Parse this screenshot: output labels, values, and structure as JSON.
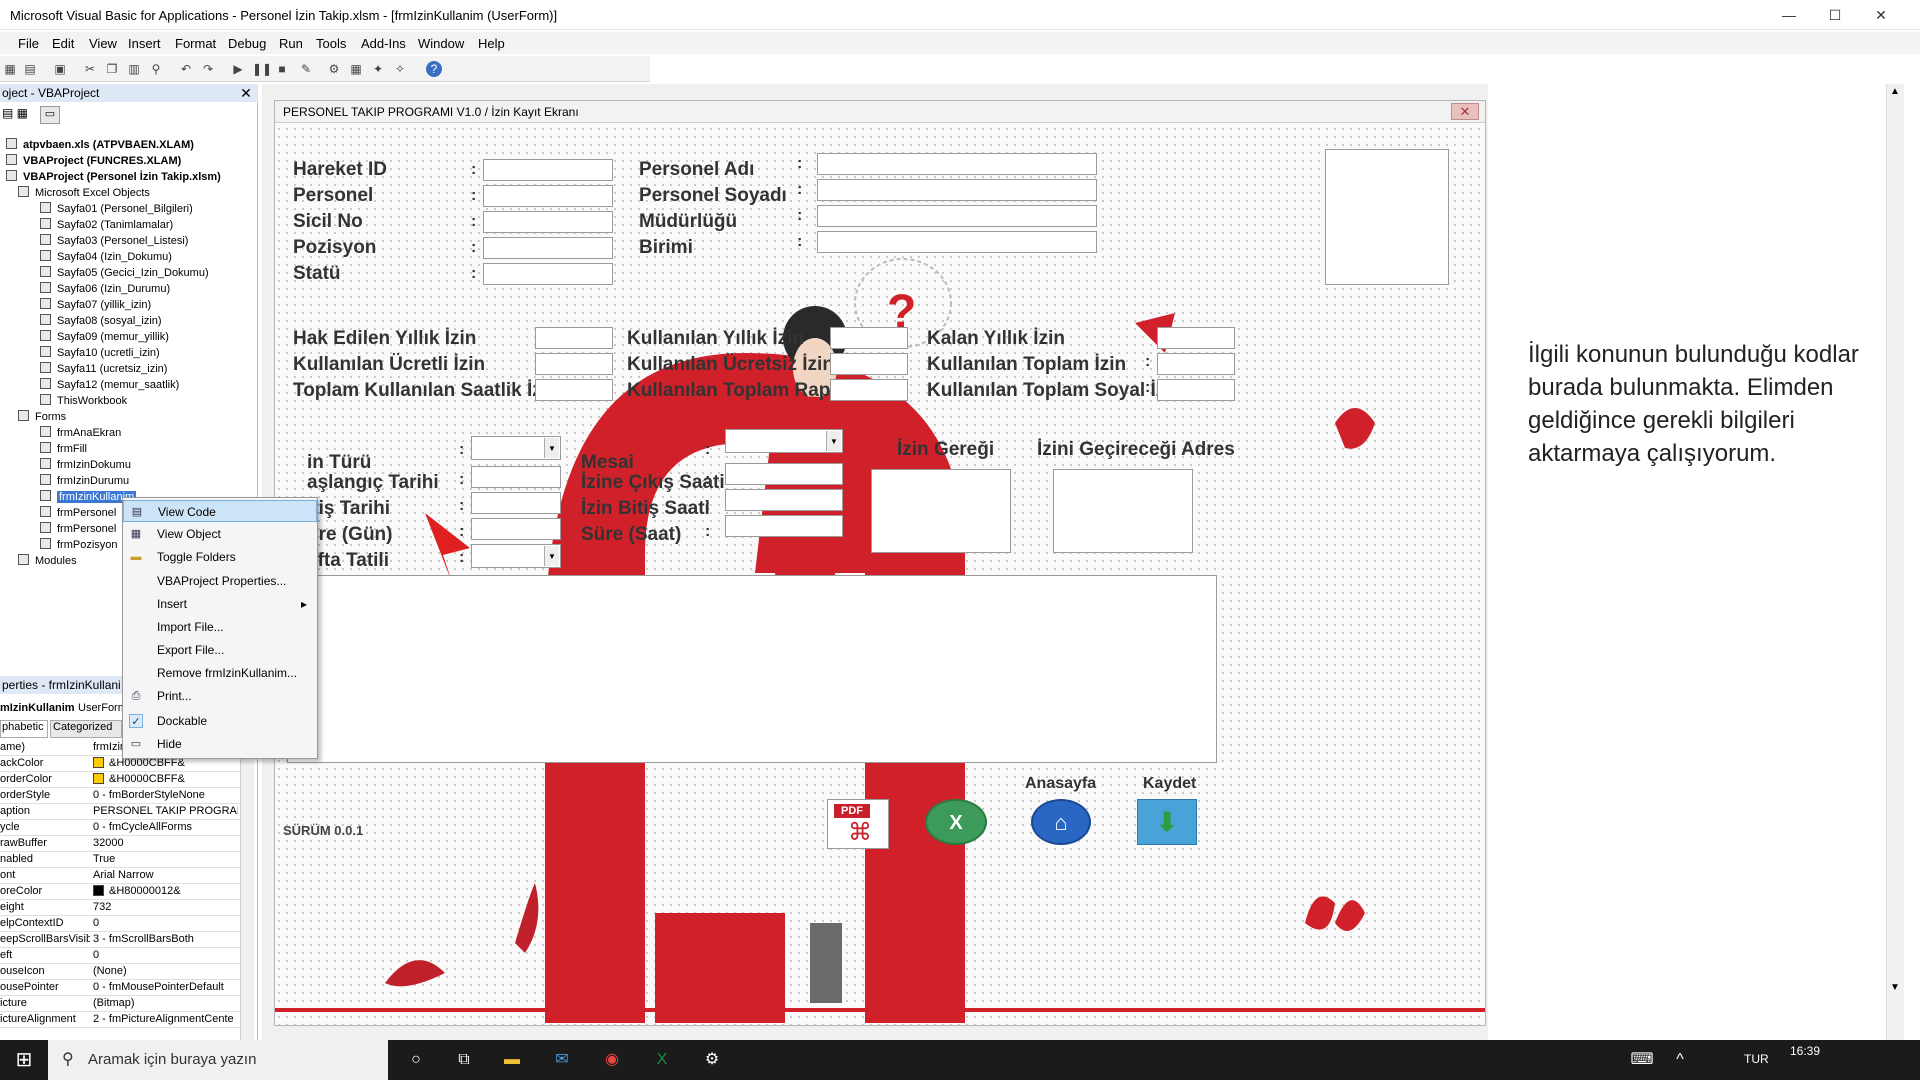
{
  "window": {
    "title": "Microsoft Visual Basic for Applications - Personel İzin Takip.xlsm - [frmIzinKullanim (UserForm)]"
  },
  "menu": [
    "File",
    "Edit",
    "View",
    "Insert",
    "Format",
    "Debug",
    "Run",
    "Tools",
    "Add-Ins",
    "Window",
    "Help"
  ],
  "project_explorer": {
    "title": "oject - VBAProject",
    "items": [
      {
        "label": "atpvbaen.xls (ATPVBAEN.XLAM)",
        "bold": true
      },
      {
        "label": "VBAProject (FUNCRES.XLAM)",
        "bold": true
      },
      {
        "label": "VBAProject (Personel İzin Takip.xlsm)",
        "bold": true
      },
      {
        "label": "Microsoft Excel Objects"
      },
      {
        "label": "Sayfa01 (Personel_Bilgileri)"
      },
      {
        "label": "Sayfa02 (Tanimlamalar)"
      },
      {
        "label": "Sayfa03 (Personel_Listesi)"
      },
      {
        "label": "Sayfa04 (Izin_Dokumu)"
      },
      {
        "label": "Sayfa05 (Gecici_Izin_Dokumu)"
      },
      {
        "label": "Sayfa06 (Izin_Durumu)"
      },
      {
        "label": "Sayfa07 (yillik_izin)"
      },
      {
        "label": "Sayfa08 (sosyal_izin)"
      },
      {
        "label": "Sayfa09 (memur_yillik)"
      },
      {
        "label": "Sayfa10 (ucretli_izin)"
      },
      {
        "label": "Sayfa11 (ucretsiz_izin)"
      },
      {
        "label": "Sayfa12 (memur_saatlik)"
      },
      {
        "label": "ThisWorkbook"
      },
      {
        "label": "Forms"
      },
      {
        "label": "frmAnaEkran"
      },
      {
        "label": "frmFill"
      },
      {
        "label": "frmIzinDokumu"
      },
      {
        "label": "frmIzinDurumu"
      },
      {
        "label": "frmIzinKullanim"
      },
      {
        "label": "frmPersonel"
      },
      {
        "label": "frmPersonel"
      },
      {
        "label": "frmPozisyon"
      },
      {
        "label": "Modules"
      }
    ]
  },
  "context_menu": {
    "items": [
      "View Code",
      "View Object",
      "Toggle Folders",
      "VBAProject Properties...",
      "Insert",
      "Import File...",
      "Export File...",
      "Remove frmIzinKullanim...",
      "Print...",
      "Dockable",
      "Hide"
    ]
  },
  "properties": {
    "title": "perties - frmIzinKullani",
    "object": "mIzinKullanim",
    "object_type": "UserForm",
    "tabs": [
      "phabetic",
      "Categorized"
    ],
    "rows": [
      {
        "k": "ame)",
        "v": "frmIzinKullanim"
      },
      {
        "k": "ackColor",
        "v": "&H0000CBFF&",
        "swatch": "#ffcb00"
      },
      {
        "k": "orderColor",
        "v": "&H0000CBFF&",
        "swatch": "#ffcb00"
      },
      {
        "k": "orderStyle",
        "v": "0 - fmBorderStyleNone"
      },
      {
        "k": "aption",
        "v": "PERSONEL TAKIP PROGRAM"
      },
      {
        "k": "ycle",
        "v": "0 - fmCycleAllForms"
      },
      {
        "k": "rawBuffer",
        "v": "32000"
      },
      {
        "k": "nabled",
        "v": "True"
      },
      {
        "k": "ont",
        "v": "Arial Narrow"
      },
      {
        "k": "oreColor",
        "v": "&H80000012&",
        "swatch": "#000000"
      },
      {
        "k": "eight",
        "v": "732"
      },
      {
        "k": "elpContextID",
        "v": "0"
      },
      {
        "k": "eepScrollBarsVisible",
        "v": "3 - fmScrollBarsBoth"
      },
      {
        "k": "eft",
        "v": "0"
      },
      {
        "k": "ouseIcon",
        "v": "(None)"
      },
      {
        "k": "ousePointer",
        "v": "0 - fmMousePointerDefault"
      },
      {
        "k": "icture",
        "v": "(Bitmap)"
      },
      {
        "k": "ictureAlignment",
        "v": "2 - fmPictureAlignmentCente"
      }
    ]
  },
  "form": {
    "caption": "PERSONEL TAKIP PROGRAMI V1.0 / İzin Kayıt Ekranı",
    "labels": {
      "hareket_id": "Hareket ID",
      "personel": "Personel",
      "sicil_no": "Sicil No",
      "pozisyon": "Pozisyon",
      "statu": "Statü",
      "personel_adi": "Personel Adı",
      "personel_soyadi": "Personel Soyadı",
      "mudurlugu": "Müdürlüğü",
      "birimi": "Birimi",
      "hak_edilen": "Hak Edilen Yıllık İzin",
      "kullanilan_ucretli": "Kullanılan Ücretli İzin",
      "toplam_saatlik": "Toplam Kullanılan Saatlik İzin",
      "kullanilan_yillik": "Kullanılan Yıllık İzin",
      "kullanilan_ucretsiz": "Kullanılan Ücretsiz İzin",
      "kullanilan_rapor": "Kullanılan Toplam Rapor",
      "kalan_yillik": "Kalan Yıllık İzin",
      "kullanilan_toplam": "Kullanılan Toplam İzin",
      "kullanilan_sosyal": "Kullanılan Toplam Soyal İzin",
      "izin_turu": "in Türü",
      "baslangic": "aşlangıç Tarihi",
      "bitis_tarihi": "itiş Tarihi",
      "sure_gun": "üre (Gün)",
      "hafta_tatili": "afta Tatili",
      "mesai": "Mesai",
      "cikis_saati": "İzine Çıkış Saati",
      "bitis_saati": "İzin Bitiş Saati",
      "sure_saat": "Süre (Saat)",
      "izin_geregi": "İzin Gereği",
      "izin_adres": "İzini Geçireceği Adres",
      "anasayfa": "Anasayfa",
      "kaydet": "Kaydet",
      "surum": "SÜRÜM 0.0.1",
      "pdf": "PDF"
    }
  },
  "note": "İlgili konunun bulunduğu kodlar burada bulunmakta. Elimden geldiğince gerekli bilgileri aktarmaya çalışıyorum.",
  "taskbar": {
    "search_placeholder": "Aramak için buraya yazın",
    "clock": "16:39",
    "lang": "TUR"
  },
  "colors": {
    "accent_red": "#d0202a",
    "selection_blue": "#3a78d4"
  }
}
